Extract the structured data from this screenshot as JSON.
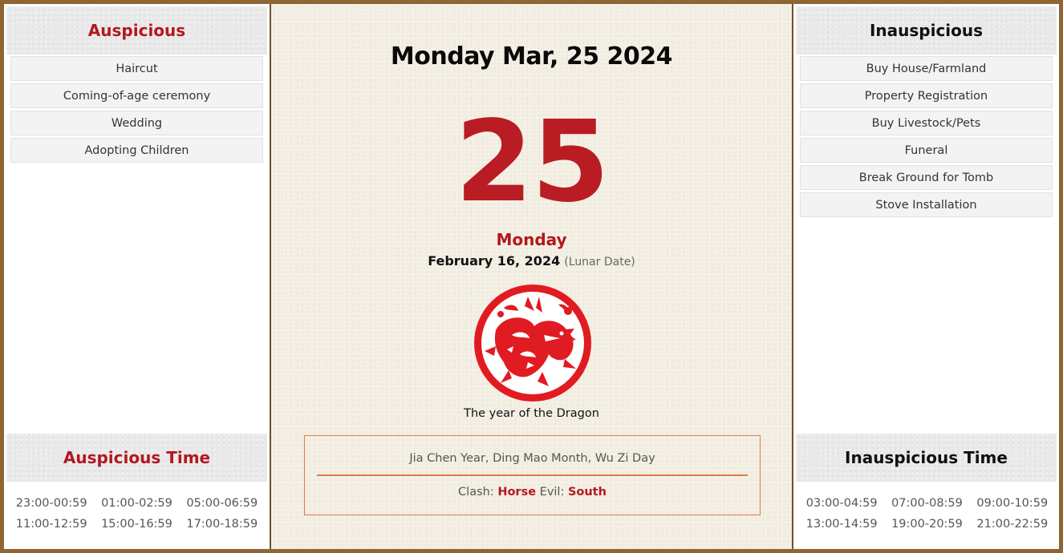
{
  "auspicious": {
    "title": "Auspicious",
    "items": [
      "Haircut",
      "Coming-of-age ceremony",
      "Wedding",
      "Adopting Children"
    ]
  },
  "inauspicious": {
    "title": "Inauspicious",
    "items": [
      "Buy House/Farmland",
      "Property Registration",
      "Buy Livestock/Pets",
      "Funeral",
      "Break Ground for Tomb",
      "Stove Installation"
    ]
  },
  "auspicious_time": {
    "title": "Auspicious Time",
    "slots": [
      "23:00-00:59",
      "01:00-02:59",
      "05:00-06:59",
      "11:00-12:59",
      "15:00-16:59",
      "17:00-18:59"
    ]
  },
  "inauspicious_time": {
    "title": "Inauspicious Time",
    "slots": [
      "03:00-04:59",
      "07:00-08:59",
      "09:00-10:59",
      "13:00-14:59",
      "19:00-20:59",
      "21:00-22:59"
    ]
  },
  "center": {
    "date_title": "Monday Mar, 25 2024",
    "day_number": "25",
    "weekday": "Monday",
    "lunar_date": "February 16, 2024",
    "lunar_note": "(Lunar Date)",
    "emblem_icon": "dragon-papercut-icon",
    "year_caption": "The year of the Dragon",
    "ganzhi": "Jia Chen Year, Ding Mao Month, Wu Zi Day",
    "clash_label": "Clash:",
    "clash_value": "Horse",
    "evil_label": "Evil:",
    "evil_value": "South"
  },
  "colors": {
    "accent_red": "#b3181f",
    "frame_brown": "#8f6535",
    "box_orange": "#e07a45"
  }
}
